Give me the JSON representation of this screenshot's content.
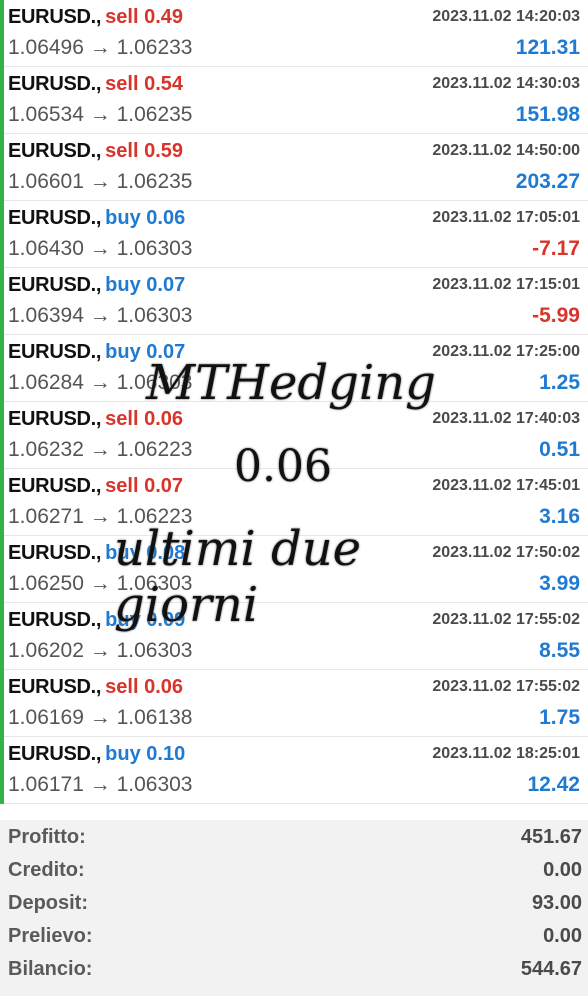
{
  "trades": [
    {
      "symbol": "EURUSD.,",
      "side": "sell",
      "lots": "0.49",
      "time": "2023.11.02 14:20:03",
      "prices": "1.06496 → 1.06233",
      "profit": "121.31"
    },
    {
      "symbol": "EURUSD.,",
      "side": "sell",
      "lots": "0.54",
      "time": "2023.11.02 14:30:03",
      "prices": "1.06534 → 1.06235",
      "profit": "151.98"
    },
    {
      "symbol": "EURUSD.,",
      "side": "sell",
      "lots": "0.59",
      "time": "2023.11.02 14:50:00",
      "prices": "1.06601 → 1.06235",
      "profit": "203.27"
    },
    {
      "symbol": "EURUSD.,",
      "side": "buy",
      "lots": "0.06",
      "time": "2023.11.02 17:05:01",
      "prices": "1.06430 → 1.06303",
      "profit": "-7.17"
    },
    {
      "symbol": "EURUSD.,",
      "side": "buy",
      "lots": "0.07",
      "time": "2023.11.02 17:15:01",
      "prices": "1.06394 → 1.06303",
      "profit": "-5.99"
    },
    {
      "symbol": "EURUSD.,",
      "side": "buy",
      "lots": "0.07",
      "time": "2023.11.02 17:25:00",
      "prices": "1.06284 → 1.06303",
      "profit": "1.25"
    },
    {
      "symbol": "EURUSD.,",
      "side": "sell",
      "lots": "0.06",
      "time": "2023.11.02 17:40:03",
      "prices": "1.06232 → 1.06223",
      "profit": "0.51"
    },
    {
      "symbol": "EURUSD.,",
      "side": "sell",
      "lots": "0.07",
      "time": "2023.11.02 17:45:01",
      "prices": "1.06271 → 1.06223",
      "profit": "3.16"
    },
    {
      "symbol": "EURUSD.,",
      "side": "buy",
      "lots": "0.08",
      "time": "2023.11.02 17:50:02",
      "prices": "1.06250 → 1.06303",
      "profit": "3.99"
    },
    {
      "symbol": "EURUSD.,",
      "side": "buy",
      "lots": "0.09",
      "time": "2023.11.02 17:55:02",
      "prices": "1.06202 → 1.06303",
      "profit": "8.55"
    },
    {
      "symbol": "EURUSD.,",
      "side": "sell",
      "lots": "0.06",
      "time": "2023.11.02 17:55:02",
      "prices": "1.06169 → 1.06138",
      "profit": "1.75"
    },
    {
      "symbol": "EURUSD.,",
      "side": "buy",
      "lots": "0.10",
      "time": "2023.11.02 18:25:01",
      "prices": "1.06171 → 1.06303",
      "profit": "12.42"
    }
  ],
  "summary": [
    {
      "label": "Profitto:",
      "value": "451.67"
    },
    {
      "label": "Credito:",
      "value": "0.00"
    },
    {
      "label": "Deposit:",
      "value": "93.00"
    },
    {
      "label": "Prelievo:",
      "value": "0.00"
    },
    {
      "label": "Bilancio:",
      "value": "544.67"
    }
  ],
  "watermark": {
    "line1": "MTHedging",
    "line2": "0.06",
    "line3": "ultimi due giorni"
  },
  "colors": {
    "sell": "#d9342b",
    "buy": "#1f7ad1",
    "positive": "#1f7ad1",
    "negative": "#d9342b",
    "row_marker": "#33b24a"
  }
}
